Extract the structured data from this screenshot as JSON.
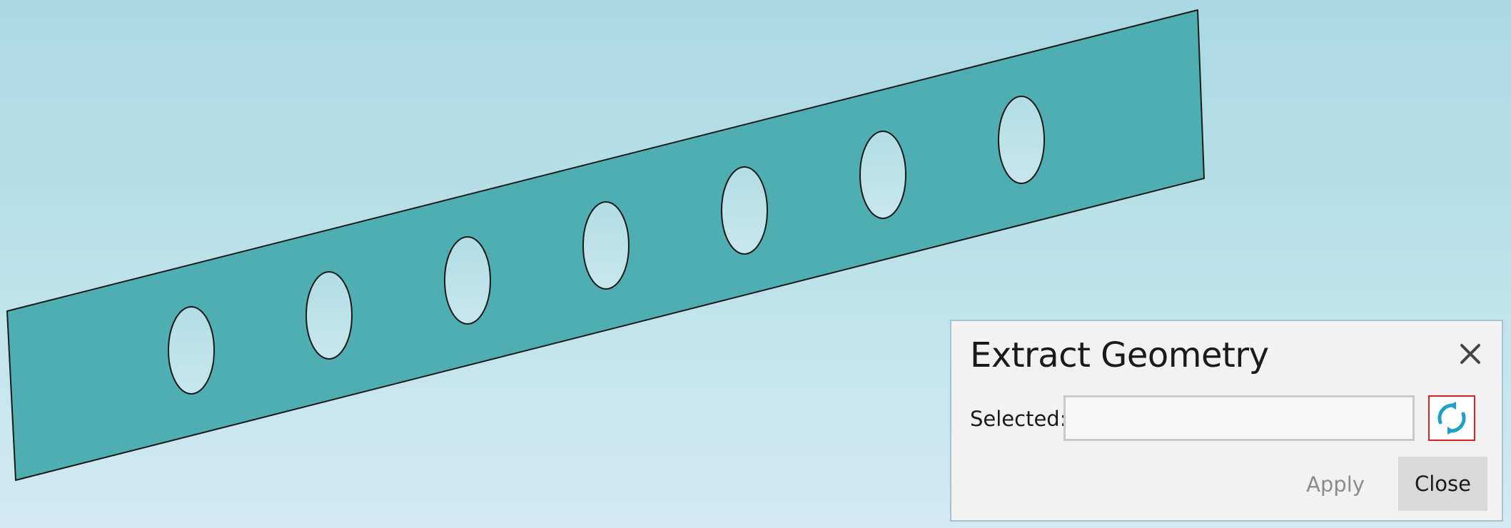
{
  "dialog": {
    "title": "Extract Geometry",
    "selected_label": "Selected:",
    "selected_value": "",
    "apply_label": "Apply",
    "close_label": "Close",
    "close_icon": "close-icon",
    "refresh_icon": "refresh-icon"
  },
  "colors": {
    "plate_fill": "#4faeb1",
    "plate_stroke": "#1a1a1a",
    "hole_fill": "#bfe2ea",
    "refresh_icon": "#1ba1c7",
    "refresh_border": "#e0201f"
  }
}
